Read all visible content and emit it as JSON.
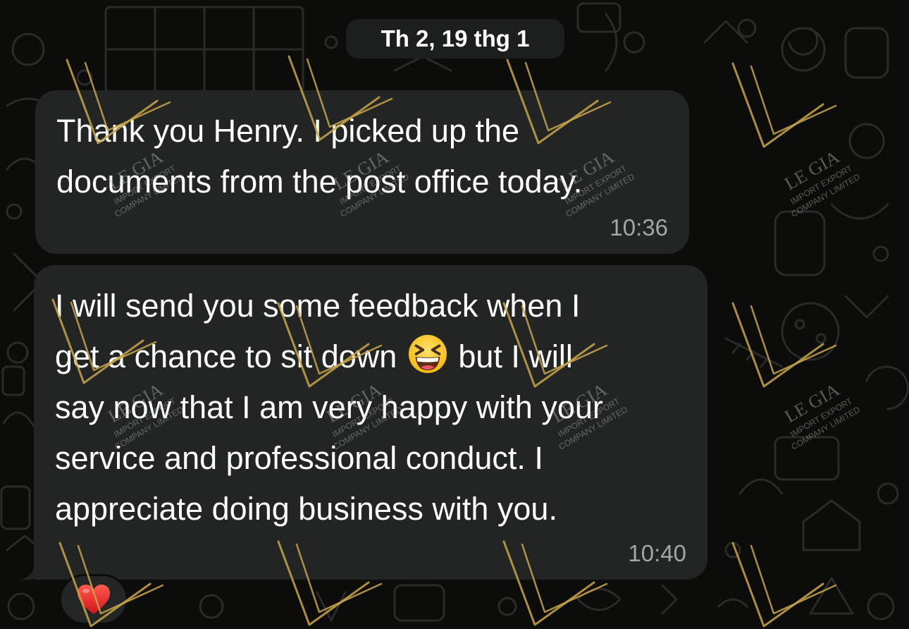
{
  "date_separator": "Th 2, 19 thg 1",
  "messages": [
    {
      "text": "Thank you Henry. I picked up the\ndocuments from the post office today.",
      "time": "10:36"
    },
    {
      "text_before_emoji": "I will send you some feedback when I\nget a chance to sit down ",
      "emoji": "grinning-squinting-face",
      "text_after_emoji": " but I will\nsay now that I am very happy with your\nservice and professional conduct. I\nappreciate doing business with you.",
      "time": "10:40",
      "reaction": "red-heart"
    }
  ],
  "watermark": {
    "name": "LE GIA",
    "line1": "IMPORT EXPORT",
    "line2": "COMPANY LIMITED"
  },
  "colors": {
    "background": "#0c0c0b",
    "bubble": "#222524",
    "date_pill": "#1d1f1e",
    "text": "#ffffff",
    "timestamp": "#a3a6a5",
    "watermark_gold": "#c9a64a"
  }
}
